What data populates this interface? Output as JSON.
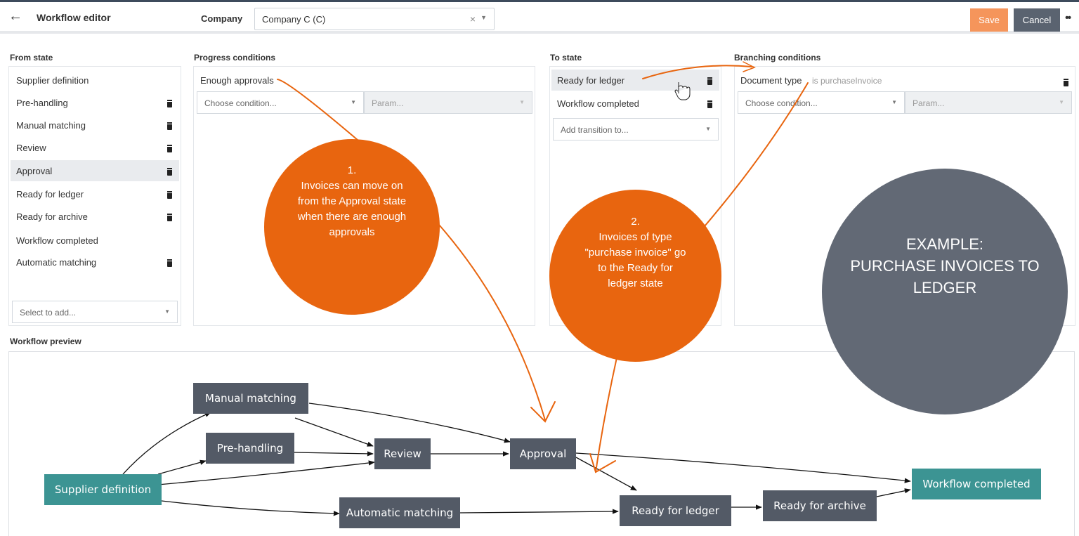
{
  "header": {
    "back_icon": "arrow-left-icon",
    "title": "Workflow editor",
    "company_label": "Company",
    "company_value": "Company C (C)",
    "clear_glyph": "×",
    "save_label": "Save",
    "cancel_label": "Cancel",
    "more_icon": "more-dots-icon"
  },
  "from_state": {
    "heading": "From state",
    "items": [
      {
        "label": "Supplier definition",
        "deletable": false
      },
      {
        "label": "Pre-handling",
        "deletable": true
      },
      {
        "label": "Manual matching",
        "deletable": true
      },
      {
        "label": "Review",
        "deletable": true
      },
      {
        "label": "Approval",
        "deletable": true,
        "selected": true
      },
      {
        "label": "Ready for ledger",
        "deletable": true
      },
      {
        "label": "Ready for archive",
        "deletable": true
      },
      {
        "label": "Workflow completed",
        "deletable": false
      },
      {
        "label": "Automatic matching",
        "deletable": true
      }
    ],
    "add_placeholder": "Select to add..."
  },
  "progress_conditions": {
    "heading": "Progress conditions",
    "condition": "Enough approvals",
    "choose_placeholder": "Choose condition...",
    "param_placeholder": "Param..."
  },
  "to_state": {
    "heading": "To state",
    "items": [
      {
        "label": "Ready for ledger",
        "selected": true
      },
      {
        "label": "Workflow completed",
        "selected": false
      }
    ],
    "add_placeholder": "Add transition to..."
  },
  "branching_conditions": {
    "heading": "Branching conditions",
    "condition_name": "Document type",
    "condition_value": "is purchaseInvoice",
    "choose_placeholder": "Choose condition...",
    "param_placeholder": "Param..."
  },
  "preview": {
    "heading": "Workflow preview",
    "nodes": {
      "supplier_definition": "Supplier definition",
      "manual_matching": "Manual matching",
      "pre_handling": "Pre-handling",
      "review": "Review",
      "approval": "Approval",
      "automatic_matching": "Automatic matching",
      "ready_for_ledger": "Ready for ledger",
      "ready_for_archive": "Ready for archive",
      "workflow_completed": "Workflow completed"
    }
  },
  "callouts": {
    "one_number": "1.",
    "one_text": "Invoices can move on from the Approval state when there are enough approvals",
    "two_number": "2.",
    "two_text": "Invoices of type \"purchase invoice\" go to the Ready for ledger state",
    "example_title": "EXAMPLE:",
    "example_text": "PURCHASE INVOICES TO LEDGER"
  },
  "colors": {
    "save": "#f5955b",
    "cancel": "#5a6370",
    "node_dark": "#535a66",
    "node_teal": "#3c9493",
    "callout_orange": "#e8650f",
    "example_grey": "#626975"
  }
}
